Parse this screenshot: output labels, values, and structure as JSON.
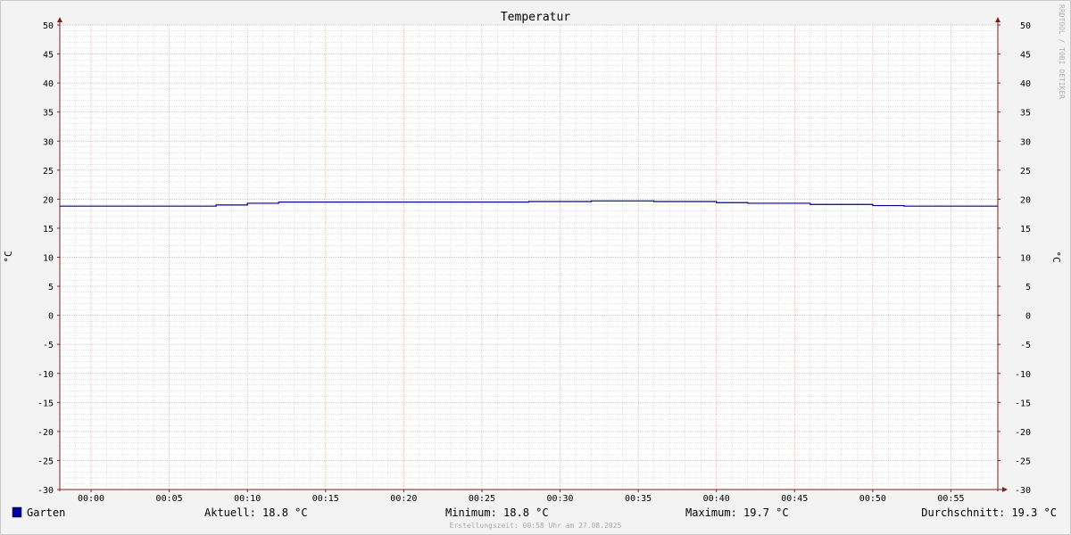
{
  "chart_data": {
    "type": "line",
    "title": "Temperatur",
    "ylabel": "°C",
    "ylabel_right": "°C",
    "ylim": [
      -30,
      50
    ],
    "yticks": [
      50,
      45,
      40,
      35,
      30,
      25,
      20,
      15,
      10,
      5,
      0,
      -5,
      -10,
      -15,
      -20,
      -25,
      -30
    ],
    "xlim_minutes": [
      -2,
      58
    ],
    "xtick_minutes": [
      0,
      5,
      10,
      15,
      20,
      25,
      30,
      35,
      40,
      45,
      50,
      55
    ],
    "xtick_labels": [
      "00:00",
      "00:05",
      "00:10",
      "00:15",
      "00:20",
      "00:25",
      "00:30",
      "00:35",
      "00:40",
      "00:45",
      "00:50",
      "00:55"
    ],
    "grid": true,
    "series": [
      {
        "name": "Garten",
        "color": "#000099",
        "step": true,
        "x_minutes": [
          -2,
          8,
          10,
          12,
          28,
          32,
          36,
          40,
          42,
          46,
          50,
          52,
          58
        ],
        "values": [
          18.8,
          19.0,
          19.3,
          19.5,
          19.6,
          19.7,
          19.6,
          19.4,
          19.3,
          19.1,
          18.9,
          18.8,
          18.8
        ]
      }
    ]
  },
  "legend": {
    "series_name": "Garten",
    "color": "#000099",
    "aktuell": "Aktuell: 18.8 °C",
    "minimum": "Minimum: 18.8 °C",
    "maximum": "Maximum: 19.7 °C",
    "durchschnitt": "Durchschnitt: 19.3 °C"
  },
  "footer": "Erstellungszeit: 00:58 Uhr am 27.08.2025",
  "watermark": "RRDTOOL / TOBI OETIKER",
  "colors": {
    "background": "#f3f3f3",
    "plot_bg": "#ffffff",
    "minor_grid": "#c8c8c8",
    "major_grid": "#e8a0a0",
    "axis": "#802020"
  }
}
